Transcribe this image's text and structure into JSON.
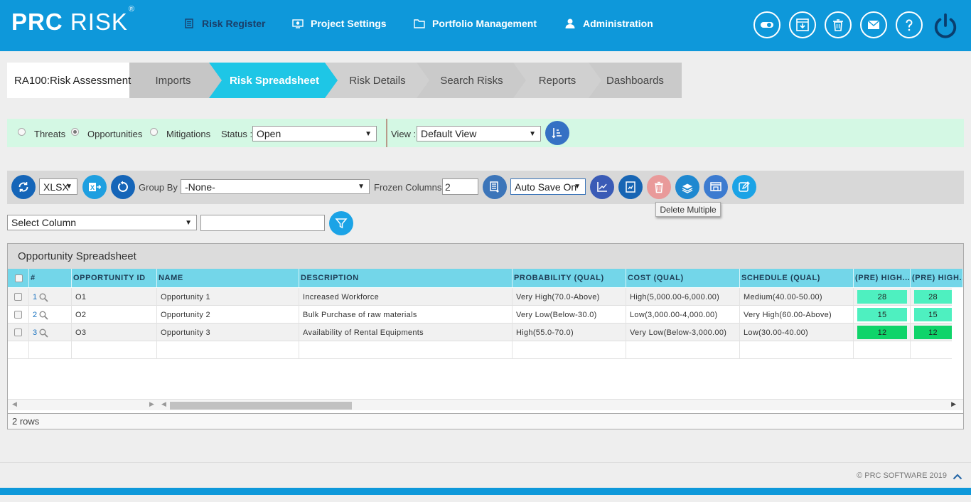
{
  "header": {
    "logo_prc": "PRC",
    "logo_risk": "RISK",
    "logo_reg": "®",
    "nav": {
      "risk_register": "Risk Register",
      "project_settings": "Project Settings",
      "portfolio_management": "Portfolio Management",
      "administration": "Administration"
    },
    "icons": [
      "toggle-icon",
      "download-icon",
      "delete-icon",
      "mail-icon",
      "help-icon",
      "power-icon"
    ]
  },
  "breadcrumb": {
    "home": "RA100:Risk Assessment",
    "steps": [
      "Imports",
      "Risk Spreadsheet",
      "Risk Details",
      "Search Risks",
      "Reports",
      "Dashboards"
    ],
    "active": "Risk Spreadsheet"
  },
  "filter": {
    "threats": "Threats",
    "opportunities": "Opportunities",
    "mitigations": "Mitigations",
    "selected": "Opportunities",
    "status_label": "Status :",
    "status_value": "Open",
    "view_label": "View :",
    "view_value": "Default View"
  },
  "toolbar": {
    "format": "XLSX",
    "group_by_label": "Group By :",
    "group_by_value": "-None-",
    "frozen_label": "Frozen Columns :",
    "frozen_value": "2",
    "autosave": "Auto Save On",
    "tooltip": "Delete Multiple"
  },
  "column_filter": {
    "select_label": "Select Column",
    "text_value": ""
  },
  "grid": {
    "title": "Opportunity Spreadsheet",
    "headers": [
      "#",
      "OPPORTUNITY ID",
      "NAME",
      "DESCRIPTION",
      "PROBABILITY (QUAL)",
      "COST (QUAL)",
      "SCHEDULE (QUAL)",
      "(PRE) HIGH...",
      "(PRE) HIGH..."
    ],
    "rows": [
      {
        "num": "1",
        "id": "O1",
        "name": "Opportunity 1",
        "description": "Increased Workforce",
        "probability": "Very High(70.0-Above)",
        "cost": "High(5,000.00-6,000.00)",
        "schedule": "Medium(40.00-50.00)",
        "pre1": "28",
        "pre2": "28",
        "color": "#4ef0c0"
      },
      {
        "num": "2",
        "id": "O2",
        "name": "Opportunity 2",
        "description": "Bulk Purchase of raw materials",
        "probability": "Very Low(Below-30.0)",
        "cost": "Low(3,000.00-4,000.00)",
        "schedule": "Very High(60.00-Above)",
        "pre1": "15",
        "pre2": "15",
        "color": "#4ef0c0"
      },
      {
        "num": "3",
        "id": "O3",
        "name": "Opportunity 3",
        "description": "Availability of Rental Equipments",
        "probability": "High(55.0-70.0)",
        "cost": "Very Low(Below-3,000.00)",
        "schedule": "Low(30.00-40.00)",
        "pre1": "12",
        "pre2": "12",
        "color": "#0fd46a"
      }
    ],
    "footer": "2 rows"
  },
  "footer": {
    "copyright": "© PRC SOFTWARE 2019"
  },
  "colors": {
    "header": "#0e98da",
    "step_active": "#1ec6e6",
    "grid_header": "#73d6e9",
    "filter_bg": "#d4f8e4"
  }
}
